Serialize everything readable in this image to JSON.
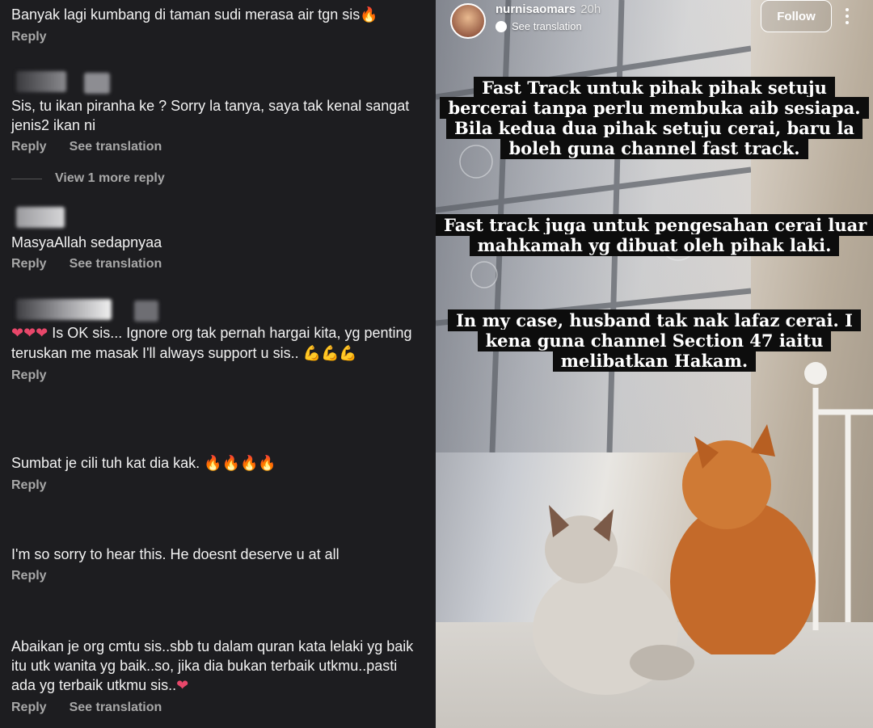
{
  "comments": [
    {
      "text": "Banyak lagi kumbang di taman sudi merasa air tgn sis",
      "emoji": "🔥",
      "reply": "Reply",
      "translation": ""
    },
    {
      "text": "Sis, tu ikan piranha ke ? Sorry la tanya, saya tak kenal sangat jenis2 ikan ni",
      "emoji": "",
      "reply": "Reply",
      "translation": "See translation"
    },
    {
      "text": "MasyaAllah sedapnyaa",
      "emoji": "",
      "reply": "Reply",
      "translation": "See translation"
    },
    {
      "text": "Is OK sis... Ignore org tak pernah hargai kita, yg penting teruskan me masak I'll always support u sis..",
      "emoji_pre": "❤❤❤",
      "emoji": "💪💪💪",
      "reply": "Reply",
      "translation": ""
    },
    {
      "text": "Sumbat je cili tuh kat dia kak.",
      "emoji": "🔥🔥🔥🔥",
      "reply": "Reply",
      "translation": ""
    },
    {
      "text": "I'm so sorry to hear this. He doesnt deserve u at all",
      "emoji": "",
      "reply": "Reply",
      "translation": ""
    },
    {
      "text": "Abaikan je org cmtu sis..sbb tu dalam quran kata lelaki yg baik itu utk wanita yg baik..so, jika dia bukan terbaik utkmu..pasti ada yg terbaik utkmu sis..",
      "emoji": "❤",
      "reply": "Reply",
      "translation": "See translation"
    }
  ],
  "view_more": "View 1 more reply",
  "story": {
    "username": "nurnisaomars",
    "time": "20h",
    "see_translation": "See translation",
    "follow": "Follow",
    "text_blocks": [
      "Fast Track untuk pihak pihak setuju bercerai tanpa perlu membuka aib sesiapa. Bila kedua dua pihak setuju cerai, baru la boleh guna channel fast track.",
      "Fast track juga untuk pengesahan cerai luar mahkamah yg dibuat oleh pihak laki.",
      "In my case, husband tak nak lafaz cerai. I kena guna channel Section 47 iaitu melibatkan Hakam."
    ]
  },
  "colors": {
    "panel_bg": "#1d1d20",
    "text": "#f2f2f2",
    "muted": "#a8a8a8",
    "heart": "#e8476a",
    "fire": "#f36b1c"
  }
}
